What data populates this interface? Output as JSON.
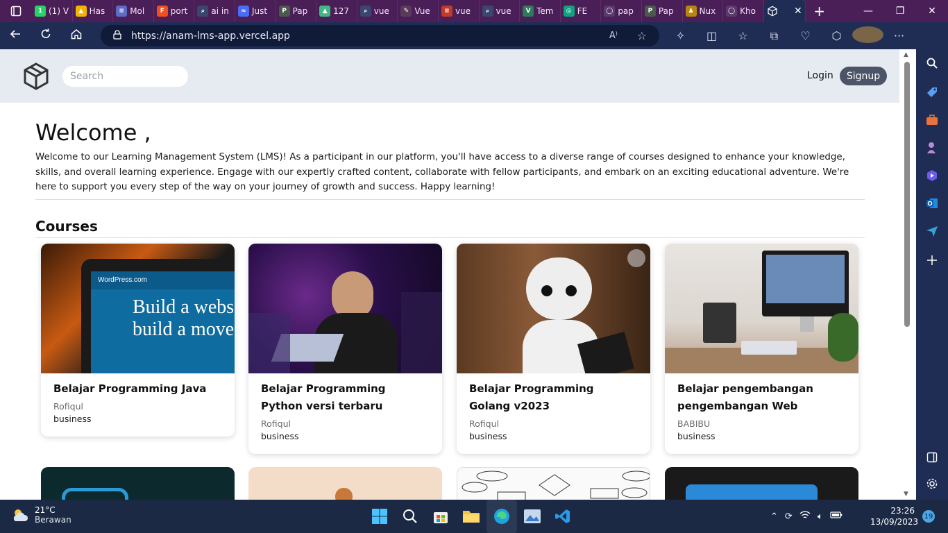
{
  "browser": {
    "tabs": [
      {
        "label": "(1) V",
        "color": "#25d366",
        "glyph": "1"
      },
      {
        "label": "Has",
        "color": "#f4b400",
        "glyph": "▲"
      },
      {
        "label": "Mol",
        "color": "#5d6bc7",
        "glyph": "≡"
      },
      {
        "label": "port",
        "color": "#f24e1e",
        "glyph": "F"
      },
      {
        "label": "ai in",
        "color": "#3a4670",
        "glyph": "⌕"
      },
      {
        "label": "Just",
        "color": "#4a6cf7",
        "glyph": "≈"
      },
      {
        "label": "Pap",
        "color": "#4a5a4a",
        "glyph": "P"
      },
      {
        "label": "127",
        "color": "#41b883",
        "glyph": "▲"
      },
      {
        "label": "vue",
        "color": "#3a4670",
        "glyph": "⌕"
      },
      {
        "label": "Vue",
        "color": "#5a3a5a",
        "glyph": "✎"
      },
      {
        "label": "vue",
        "color": "#c0392b",
        "glyph": "≡"
      },
      {
        "label": "vue",
        "color": "#3a4670",
        "glyph": "⌕"
      },
      {
        "label": "Tem",
        "color": "#2c7a5a",
        "glyph": "V"
      },
      {
        "label": "FE",
        "color": "#10a37f",
        "glyph": "◎"
      },
      {
        "label": "pap",
        "color": "#5a3a6a",
        "glyph": "◯"
      },
      {
        "label": "Pap",
        "color": "#4a5a4a",
        "glyph": "P"
      },
      {
        "label": "Nux",
        "color": "#b8860b",
        "glyph": "♟"
      },
      {
        "label": "Kho",
        "color": "#5a3a6a",
        "glyph": "◯"
      }
    ],
    "active_tab_close": "✕",
    "new_tab": "+",
    "url": "https://anam-lms-app.vercel.app",
    "read_aloud": "A⁾",
    "window_controls": [
      "—",
      "❐",
      "✕"
    ]
  },
  "site": {
    "search_placeholder": "Search",
    "login_label": "Login",
    "signup_label": "Signup",
    "welcome_title": "Welcome ,",
    "intro_text": "Welcome to our Learning Management System (LMS)! As a participant in our platform, you'll have access to a diverse range of courses designed to enhance your knowledge, skills, and overall learning experience. Engage with our expertly crafted content, collaborate with fellow participants, and embark on an exciting educational adventure. We're here to support you every step of the way on your journey of growth and success. Happy learning!",
    "courses_heading": "Courses",
    "courses": [
      {
        "title": "Belajar Programming Java",
        "author": "Rofiqul",
        "category": "business",
        "image_text_1": "Build a webs",
        "image_text_2": "build a move",
        "image_brand": "WordPress.com"
      },
      {
        "title": "Belajar Programming Python versi terbaru",
        "author": "Rofiqul",
        "category": "business"
      },
      {
        "title": "Belajar Programming Golang v2023",
        "author": "Rofiqul",
        "category": "business"
      },
      {
        "title": "Belajar pengembangan pengembangan Web",
        "author": "BABIBU",
        "category": "business"
      }
    ]
  },
  "taskbar": {
    "temperature": "21°C",
    "weather": "Berawan",
    "time": "23:26",
    "date": "13/09/2023",
    "notifications": "19"
  }
}
